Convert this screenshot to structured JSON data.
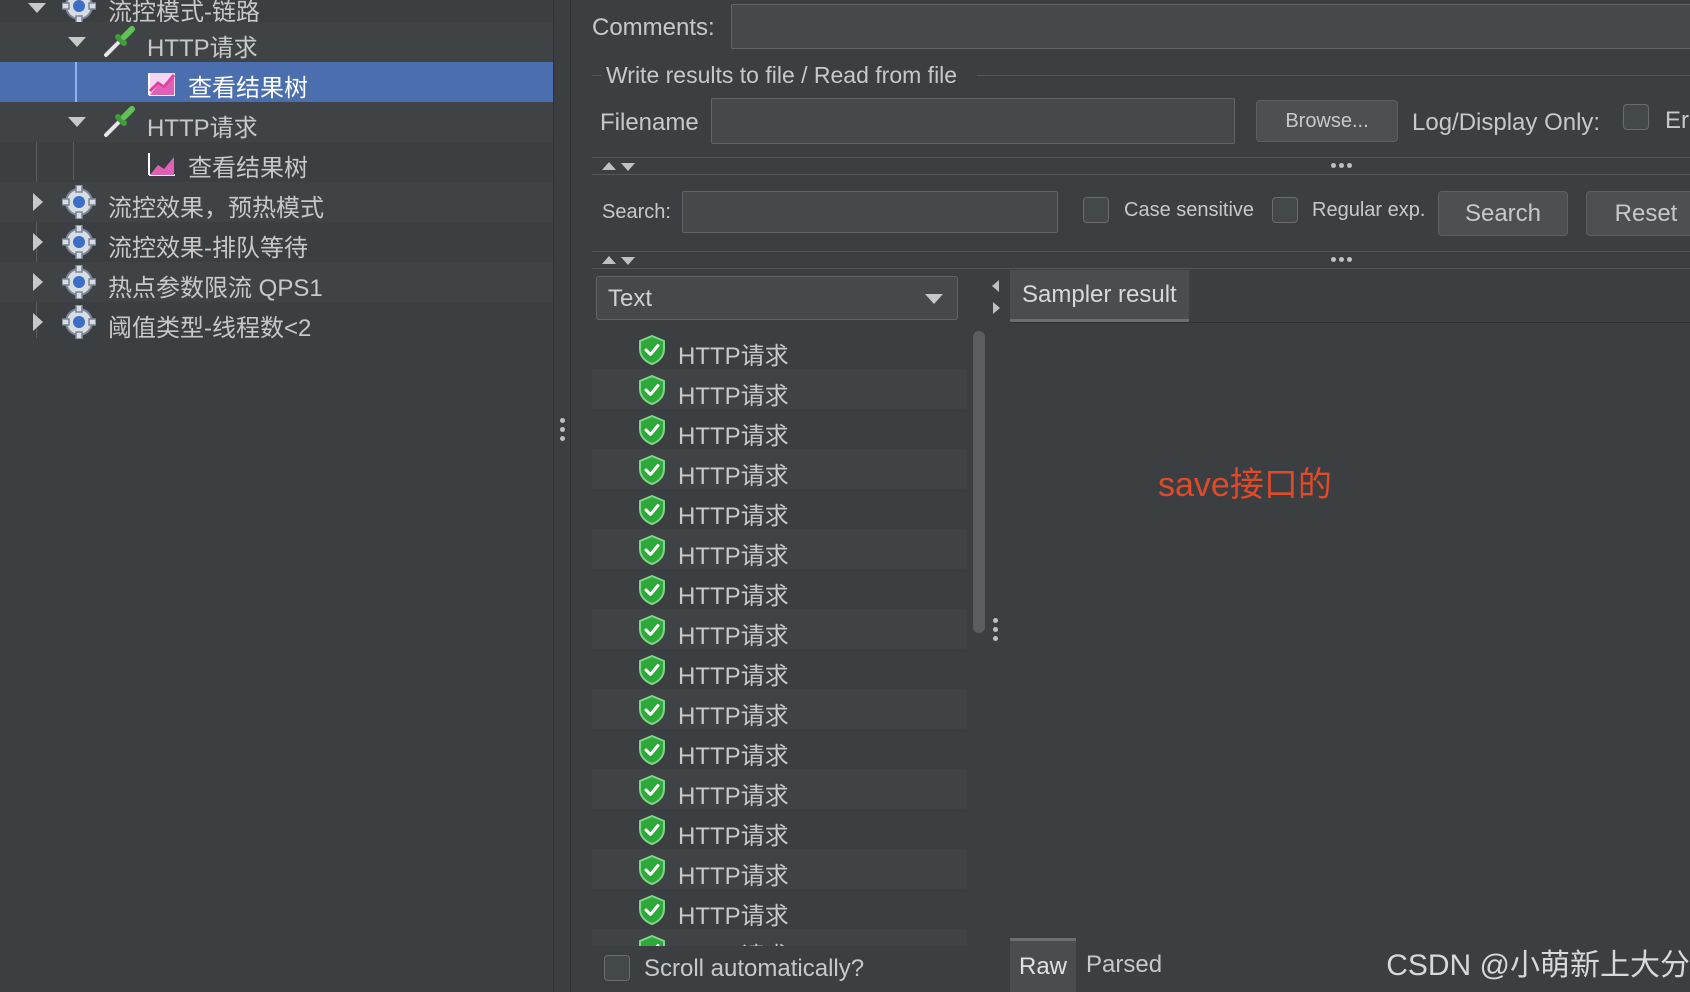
{
  "tree": {
    "items": [
      {
        "label": "流控模式-链路",
        "kind": "thread-group",
        "level": 0,
        "expanded": true
      },
      {
        "label": "HTTP请求",
        "kind": "sampler",
        "level": 1,
        "expanded": true
      },
      {
        "label": "查看结果树",
        "kind": "listener",
        "level": 2,
        "selected": true
      },
      {
        "label": "HTTP请求",
        "kind": "sampler",
        "level": 1,
        "expanded": true
      },
      {
        "label": "查看结果树",
        "kind": "listener",
        "level": 2
      },
      {
        "label": "流控效果，预热模式",
        "kind": "thread-group",
        "level": 0,
        "expanded": false
      },
      {
        "label": "流控效果-排队等待",
        "kind": "thread-group",
        "level": 0,
        "expanded": false
      },
      {
        "label": "热点参数限流 QPS1",
        "kind": "thread-group",
        "level": 0,
        "expanded": false
      },
      {
        "label": "阈值类型-线程数<2",
        "kind": "thread-group",
        "level": 0,
        "expanded": false
      }
    ]
  },
  "comments": {
    "label": "Comments:",
    "value": ""
  },
  "write_results": {
    "title": "Write results to file / Read from file",
    "filename_label": "Filename",
    "filename_value": "",
    "browse_label": "Browse...",
    "log_display_label": "Log/Display Only:",
    "errors_label": "Err"
  },
  "search": {
    "label": "Search:",
    "value": "",
    "case_sensitive_label": "Case sensitive",
    "regular_exp_label": "Regular exp.",
    "search_button": "Search",
    "reset_button": "Reset"
  },
  "renderer": {
    "selected": "Text"
  },
  "results": {
    "items": [
      "HTTP请求",
      "HTTP请求",
      "HTTP请求",
      "HTTP请求",
      "HTTP请求",
      "HTTP请求",
      "HTTP请求",
      "HTTP请求",
      "HTTP请求",
      "HTTP请求",
      "HTTP请求",
      "HTTP请求",
      "HTTP请求",
      "HTTP请求",
      "HTTP请求",
      "HTTP请求"
    ],
    "scroll_auto_label": "Scroll automatically?"
  },
  "sampler": {
    "tab_label": "Sampler result",
    "annotation": "save接口的",
    "raw_tab": "Raw",
    "parsed_tab": "Parsed"
  },
  "watermark": "CSDN @小萌新上大分",
  "colors": {
    "background": "#3c3f41",
    "selection": "#4b6eaf",
    "annotation": "#e04a2b",
    "success_shield": "#2fa83a"
  }
}
